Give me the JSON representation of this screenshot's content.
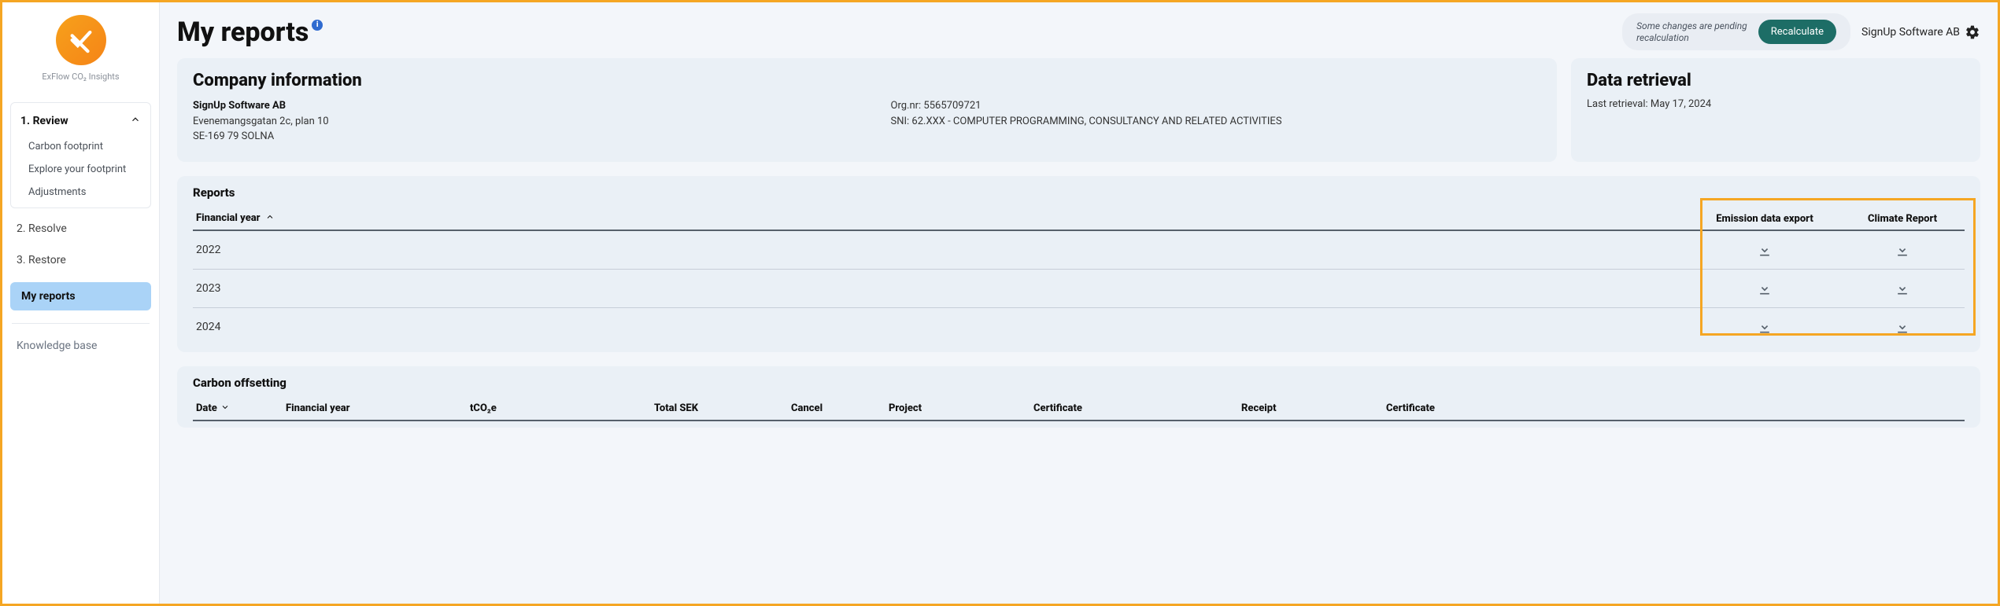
{
  "app": {
    "logo_sub": "ExFlow CO₂ Insights"
  },
  "sidebar": {
    "group_title": "1. Review",
    "items": [
      "Carbon footprint",
      "Explore your footprint",
      "Adjustments"
    ],
    "plain": [
      "2. Resolve",
      "3. Restore"
    ],
    "active": "My reports",
    "bottom": "Knowledge base"
  },
  "header": {
    "title": "My reports",
    "pending_text": "Some changes are pending\nrecalculation",
    "recalc_label": "Recalculate",
    "company": "SignUp Software AB"
  },
  "company_card": {
    "title": "Company information",
    "name": "SignUp Software AB",
    "street": "Evenemangsgatan 2c, plan 10",
    "city": "SE-169 79 SOLNA",
    "orgnr": "Org.nr: 5565709721",
    "sni": "SNI: 62.XXX - COMPUTER PROGRAMMING, CONSULTANCY AND RELATED ACTIVITIES"
  },
  "retrieval_card": {
    "title": "Data retrieval",
    "text": "Last retrieval: May 17, 2024"
  },
  "reports_section": {
    "title": "Reports",
    "fy_header": "Financial year",
    "export_header": "Emission data export",
    "climate_header": "Climate Report",
    "rows": [
      "2022",
      "2023",
      "2024"
    ]
  },
  "offsetting": {
    "title": "Carbon offsetting",
    "cols": {
      "date": "Date",
      "fy": "Financial year",
      "tco2e": "tCO₂e",
      "total": "Total SEK",
      "cancel": "Cancel",
      "project": "Project",
      "certificate1": "Certificate",
      "receipt": "Receipt",
      "certificate2": "Certificate"
    }
  }
}
